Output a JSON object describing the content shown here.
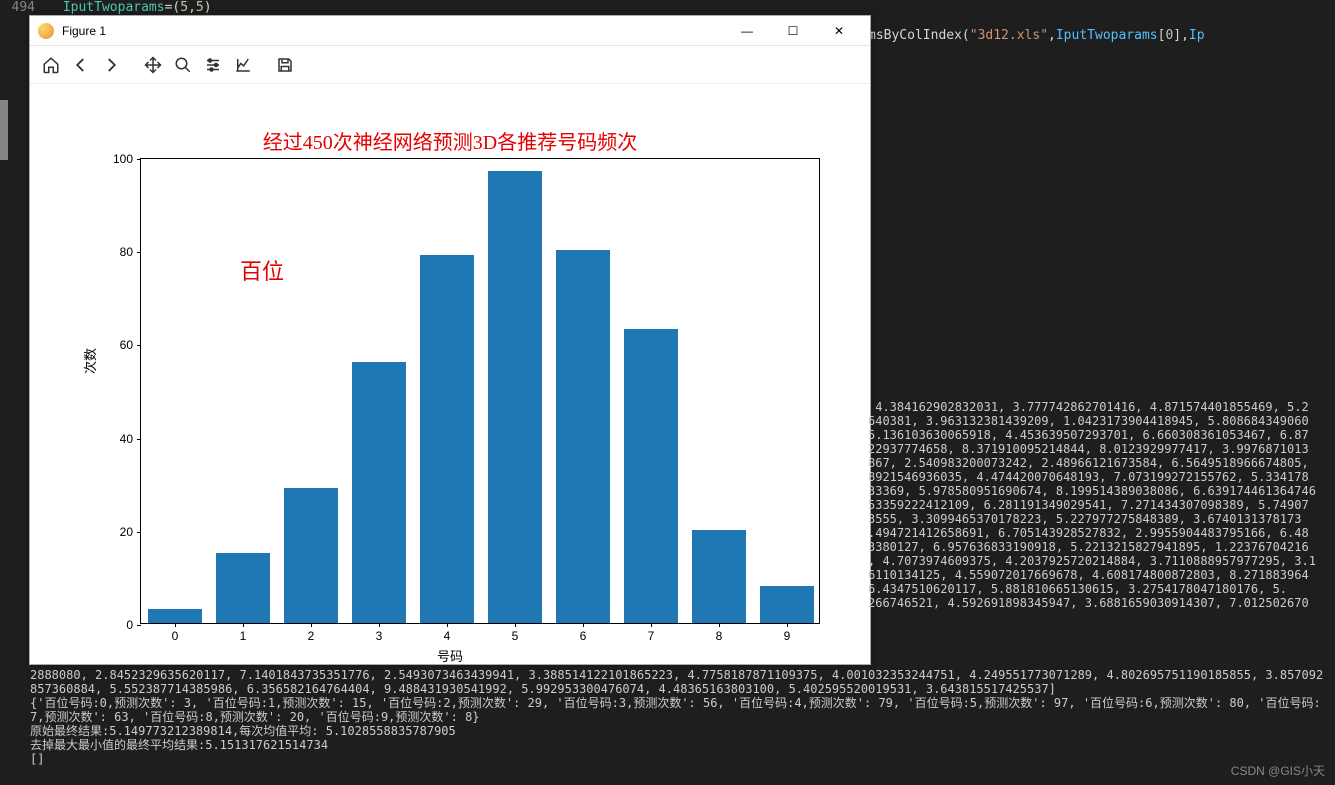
{
  "editor": {
    "line_number": "494",
    "code_line": "IputTwoparams=(5,5)",
    "overflow_line": "msByColIndex(\"3d12.xls\",IputTwoparams[0],Ip"
  },
  "window": {
    "title": "Figure 1",
    "minimize": "—",
    "maximize": "☐",
    "close": "✕"
  },
  "chart_data": {
    "type": "bar",
    "categories": [
      "0",
      "1",
      "2",
      "3",
      "4",
      "5",
      "6",
      "7",
      "8",
      "9"
    ],
    "values": [
      3,
      15,
      29,
      56,
      79,
      97,
      80,
      63,
      20,
      8
    ],
    "title": "经过450次神经网络预测3D各推荐号码频次",
    "annotation": "百位",
    "xlabel": "号码",
    "ylabel": "次数",
    "ylim": [
      0,
      100
    ],
    "yticks": [
      0,
      20,
      40,
      60,
      80,
      100
    ]
  },
  "console": {
    "side_lines": [
      " 4.384162902832031, 3.777742862701416, 4.871574401855469, 5.2",
      "640381, 3.963132381439209, 1.0423173904418945, 5.808684349060",
      "5.136103630065918, 4.453639507293701, 6.660308361053467, 6.87",
      "22937774658, 8.371910095214844, 8.0123929977417, 3.9976871013",
      "867, 2.540983200073242, 2.48966121673584, 6.5649518966674805,",
      "8921546936035, 4.474420070648193, 7.073199272155762, 5.334178",
      "33369, 5.978580951690674, 8.199514389038086, 6.639174461364746",
      "53359222412109, 6.281191349029541, 7.271434307098389, 5.74907",
      "3555, 3.3099465370178223, 5.227977275848389, 3.6740131378173",
      ".494721412658691, 6.705143928527832, 2.9955904483795166, 6.48",
      "3380127, 6.957636833190918, 5.2213215827941895, 1.22376704216",
      ", 4.7073974609375, 4.2037925720214884, 3.7110888957977295, 3.1",
      "6110134125, 4.559072017669678, 4.608174800872803, 8.271883964",
      "6.4347510620117, 5.881810665130615, 3.2754178047180176, 5.",
      "266746521, 4.592691898345947, 3.6881659030914307, 7.012502670"
    ],
    "bottom_text": "2888080, 2.8452329635620117, 7.1401843735351776, 2.5493073463439941, 3.388514122101865223, 4.7758187871109375, 4.001032353244751, 4.249551773071289, 4.802695751190185855, 3.857092857360884, 5.552387714385986, 6.356582164764404, 9.488431930541992, 5.992953300476074, 4.48365163803100, 5.402595520019531, 3.643815517425537]\n{'百位号码:0,预测次数': 3, '百位号码:1,预测次数': 15, '百位号码:2,预测次数': 29, '百位号码:3,预测次数': 56, '百位号码:4,预测次数': 79, '百位号码:5,预测次数': 97, '百位号码:6,预测次数': 80, '百位号码:7,预测次数': 63, '百位号码:8,预测次数': 20, '百位号码:9,预测次数': 8}\n原始最终结果:5.149773212389814,每次均值平均: 5.1028558835787905\n去掉最大最小值的最终平均结果:5.151317621514734\n[]"
  },
  "watermark": "CSDN @GIS小天"
}
